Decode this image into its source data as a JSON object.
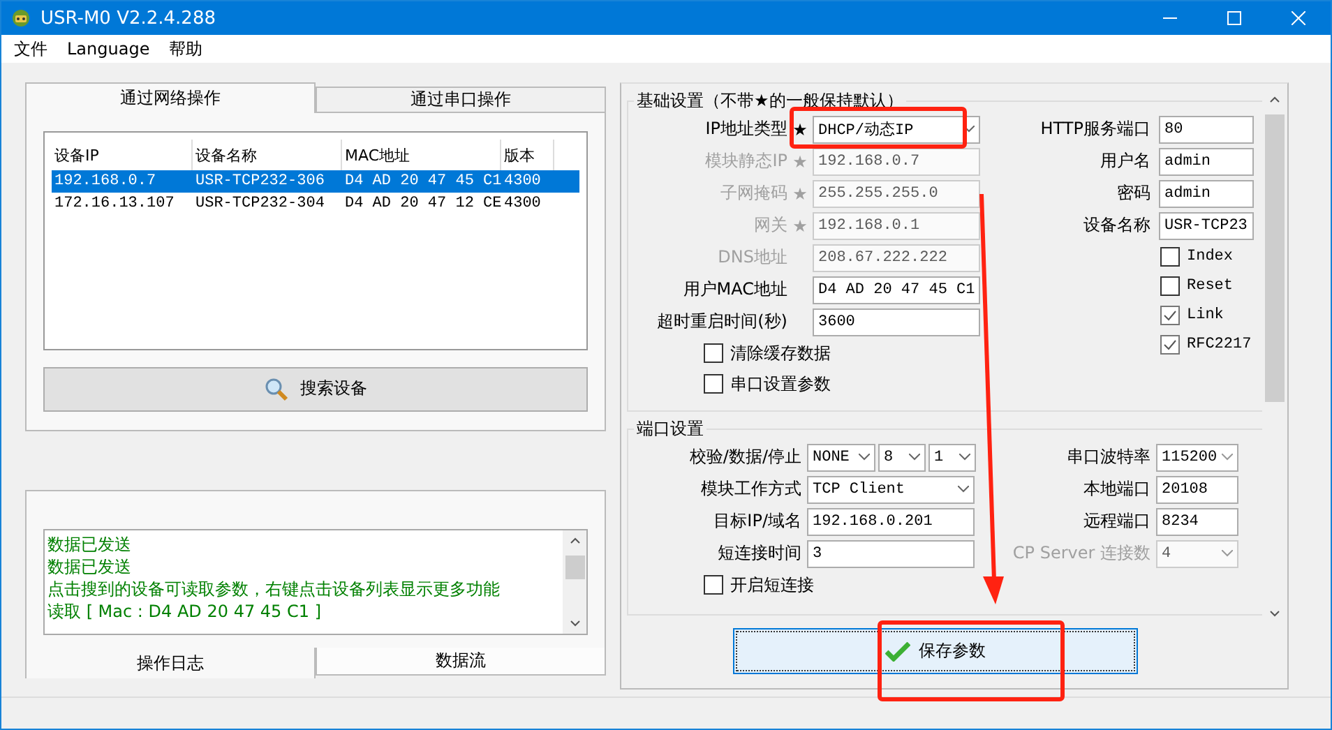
{
  "window": {
    "title": "USR-M0 V2.2.4.288"
  },
  "menu": [
    "文件",
    "Language",
    "帮助"
  ],
  "device_tabs": [
    {
      "label": "通过网络操作",
      "selected": true
    },
    {
      "label": "通过串口操作",
      "selected": false
    }
  ],
  "device_table": {
    "columns": [
      "设备IP",
      "设备名称",
      "MAC地址",
      "版本"
    ],
    "rows": [
      {
        "cells": [
          "192.168.0.7",
          "USR-TCP232-306",
          "D4 AD 20 47 45 C1",
          "4300"
        ],
        "selected": true
      },
      {
        "cells": [
          "172.16.13.107",
          "USR-TCP232-304",
          "D4 AD 20 47 12 CE",
          "4300"
        ],
        "selected": false
      }
    ]
  },
  "search_button": "搜索设备",
  "log": {
    "lines": [
      "数据已发送",
      "数据已发送",
      "点击搜到的设备可读取参数，右键点击设备列表显示更多功能",
      "读取 [ Mac : D4 AD 20 47 45 C1 ]"
    ]
  },
  "log_tabs": [
    {
      "label": "操作日志",
      "selected": true
    },
    {
      "label": "数据流",
      "selected": false
    }
  ],
  "basic_settings": {
    "title": "基础设置（不带★的一般保持默认）",
    "fields": [
      {
        "label": "IP地址类型",
        "marker": "★",
        "value": "DHCP/动态IP",
        "kind": "select",
        "disabled": false
      },
      {
        "label": "模块静态IP",
        "marker": "★",
        "value": "192.168.0.7",
        "kind": "input",
        "disabled": true
      },
      {
        "label": "子网掩码",
        "marker": "★",
        "value": "255.255.255.0",
        "kind": "input",
        "disabled": true
      },
      {
        "label": "网关",
        "marker": "★",
        "value": "192.168.0.1",
        "kind": "input",
        "disabled": true
      },
      {
        "label": "DNS地址",
        "value": "208.67.222.222",
        "kind": "input",
        "disabled": true
      },
      {
        "label": "用户MAC地址",
        "value": "D4 AD 20 47 45 C1",
        "kind": "input",
        "disabled": false
      },
      {
        "label": "超时重启时间(秒)",
        "value": "3600",
        "kind": "input",
        "disabled": false
      }
    ],
    "checkboxes": [
      {
        "label": "清除缓存数据",
        "checked": false
      },
      {
        "label": "串口设置参数",
        "checked": false
      }
    ],
    "right_fields": [
      {
        "label": "HTTP服务端口",
        "value": "80"
      },
      {
        "label": "用户名",
        "value": "admin"
      },
      {
        "label": "密码",
        "value": "admin"
      },
      {
        "label": "设备名称",
        "value": "USR-TCP23"
      }
    ],
    "right_checkboxes": [
      {
        "label": "Index",
        "checked": false
      },
      {
        "label": "Reset",
        "checked": false
      },
      {
        "label": "Link",
        "checked": true
      },
      {
        "label": "RFC2217",
        "checked": true
      }
    ]
  },
  "port_settings": {
    "title": "端口设置",
    "fields": [
      {
        "label": "校验/数据/停止",
        "kind": "triple",
        "values": [
          "NONE",
          "8",
          "1"
        ]
      },
      {
        "label": "模块工作方式",
        "kind": "select",
        "value": "TCP Client"
      },
      {
        "label": "目标IP/域名",
        "kind": "input",
        "value": "192.168.0.201"
      },
      {
        "label": "短连接时间",
        "kind": "input",
        "value": "3"
      }
    ],
    "checkboxes": [
      {
        "label": "开启短连接",
        "checked": false
      }
    ],
    "right_fields": [
      {
        "label": "串口波特率",
        "kind": "select",
        "value": "115200",
        "disabled": false
      },
      {
        "label": "本地端口",
        "kind": "input",
        "value": "20108",
        "disabled": false
      },
      {
        "label": "远程端口",
        "kind": "input",
        "value": "8234",
        "disabled": false
      },
      {
        "label": "CP Server 连接数",
        "kind": "select",
        "value": "4",
        "disabled": true
      }
    ]
  },
  "save_button": "保存参数"
}
